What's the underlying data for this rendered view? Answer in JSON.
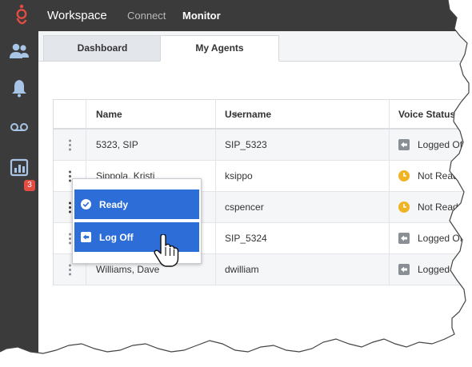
{
  "header": {
    "app_title": "Workspace",
    "nav": {
      "connect": "Connect",
      "monitor": "Monitor"
    }
  },
  "sidebar": {
    "items": [
      {
        "icon": "agents-icon"
      },
      {
        "icon": "bell-icon"
      },
      {
        "icon": "voicemail-icon"
      },
      {
        "icon": "reports-icon",
        "badge": "3"
      }
    ]
  },
  "tabs": {
    "dashboard": "Dashboard",
    "my_agents": "My Agents",
    "active": "My Agents"
  },
  "table": {
    "headers": {
      "name": "Name",
      "username": "Username",
      "voice_status": "Voice Status"
    },
    "rows": [
      {
        "name": "5323, SIP",
        "username": "SIP_5323",
        "status": "Logged Off",
        "status_type": "logged-off"
      },
      {
        "name": "Sippola, Kristi",
        "username": "ksippo",
        "status": "Not Ready",
        "status_type": "not-ready"
      },
      {
        "name": "",
        "username": "cspencer",
        "status": "Not Ready",
        "status_type": "not-ready"
      },
      {
        "name": "",
        "username": "SIP_5324",
        "status": "Logged Off",
        "status_type": "logged-off"
      },
      {
        "name": "Williams, Dave",
        "username": "dwilliam",
        "status": "Logged Off",
        "status_type": "logged-off"
      }
    ]
  },
  "context_menu": {
    "ready": "Ready",
    "log_off": "Log Off"
  },
  "colors": {
    "accent": "#2d6dd8",
    "brand": "#e54d42",
    "not_ready": "#f0b323",
    "dark_bar": "#3b3b3b"
  }
}
